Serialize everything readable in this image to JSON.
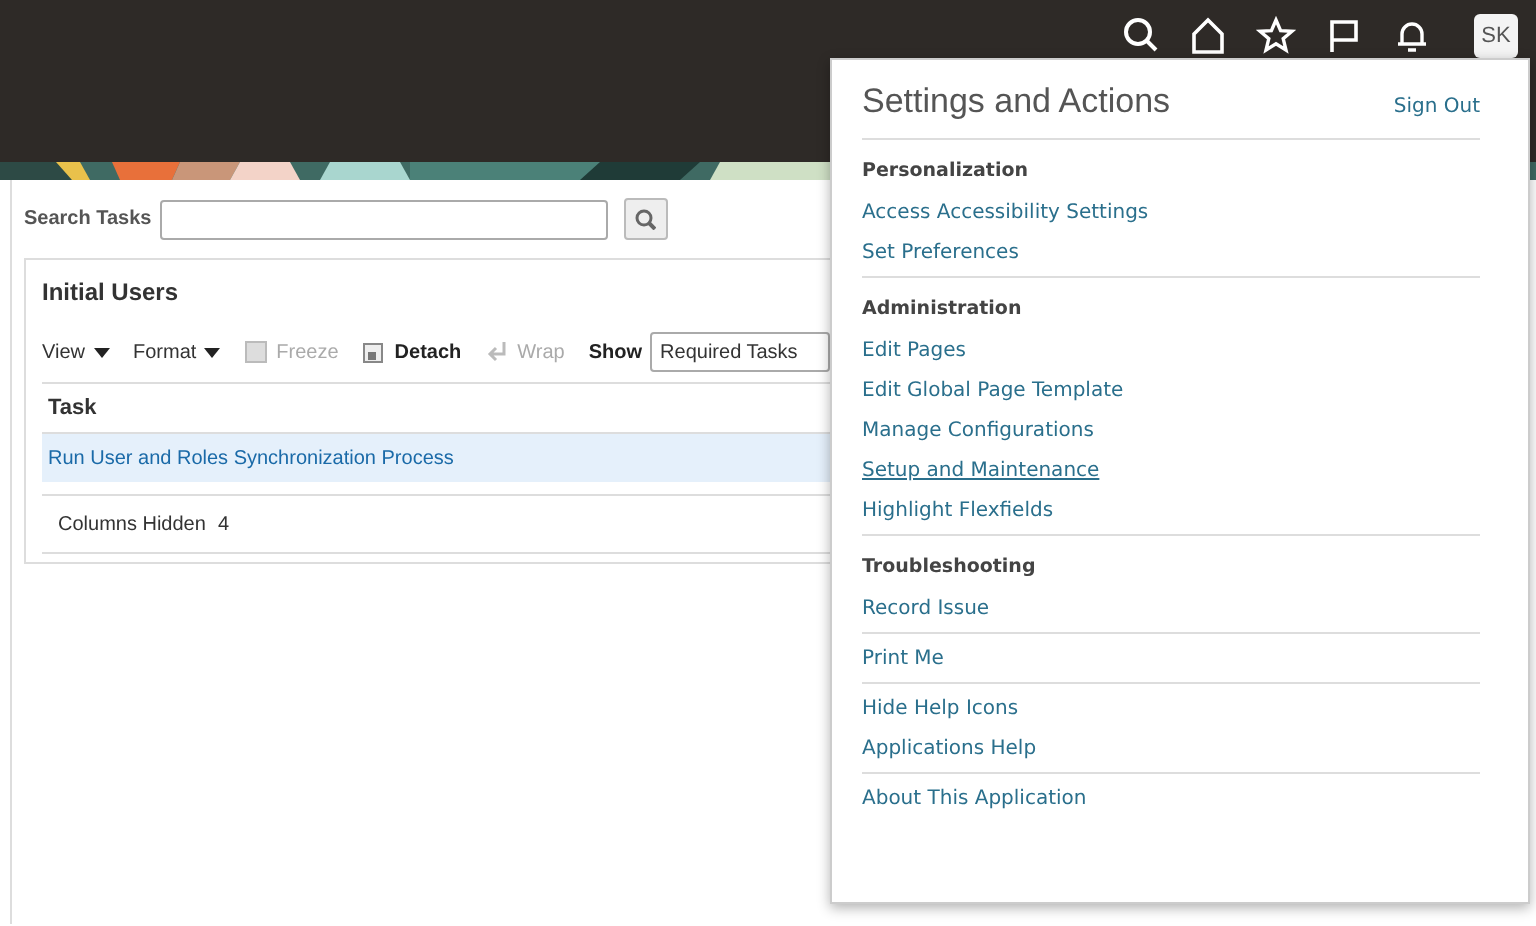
{
  "header": {
    "avatar": "SK"
  },
  "search": {
    "label": "Search Tasks"
  },
  "panel": {
    "title": "Initial Users",
    "toolbar": [
      {
        "kind": "menu",
        "label": "View",
        "disabled": false
      },
      {
        "kind": "menu",
        "label": "Format",
        "disabled": false
      },
      {
        "kind": "action",
        "label": "Freeze",
        "disabled": true
      },
      {
        "kind": "action",
        "label": "Detach",
        "disabled": false
      },
      {
        "kind": "action",
        "label": "Wrap",
        "disabled": true
      },
      {
        "kind": "select",
        "label": "Show",
        "value": "Required Tasks"
      }
    ],
    "columns": [
      "Task"
    ],
    "rows": [
      {
        "task": "Run User and Roles Synchronization Process",
        "selected": true
      }
    ],
    "columns_hidden": {
      "label": "Columns Hidden",
      "count": "4"
    }
  },
  "menu": {
    "title": "Settings and Actions",
    "sign_out": "Sign Out",
    "sections": [
      {
        "heading": "Personalization",
        "items": [
          {
            "label": "Access Accessibility Settings",
            "focused": false
          },
          {
            "label": "Set Preferences",
            "focused": false
          }
        ]
      },
      {
        "heading": "Administration",
        "items": [
          {
            "label": "Edit Pages",
            "focused": false
          },
          {
            "label": "Edit Global Page Template",
            "focused": false
          },
          {
            "label": "Manage Configurations",
            "focused": false
          },
          {
            "label": "Setup and Maintenance",
            "focused": true
          },
          {
            "label": "Highlight Flexfields",
            "focused": false
          }
        ]
      },
      {
        "heading": "Troubleshooting",
        "items": [
          {
            "label": "Record Issue",
            "focused": false
          }
        ]
      },
      {
        "items": [
          {
            "label": "Print Me",
            "focused": false
          }
        ]
      },
      {
        "items": [
          {
            "label": "Hide Help Icons",
            "focused": false
          },
          {
            "label": "Applications Help",
            "focused": false
          }
        ]
      },
      {
        "items": [
          {
            "label": "About This Application",
            "focused": false
          }
        ]
      }
    ]
  }
}
